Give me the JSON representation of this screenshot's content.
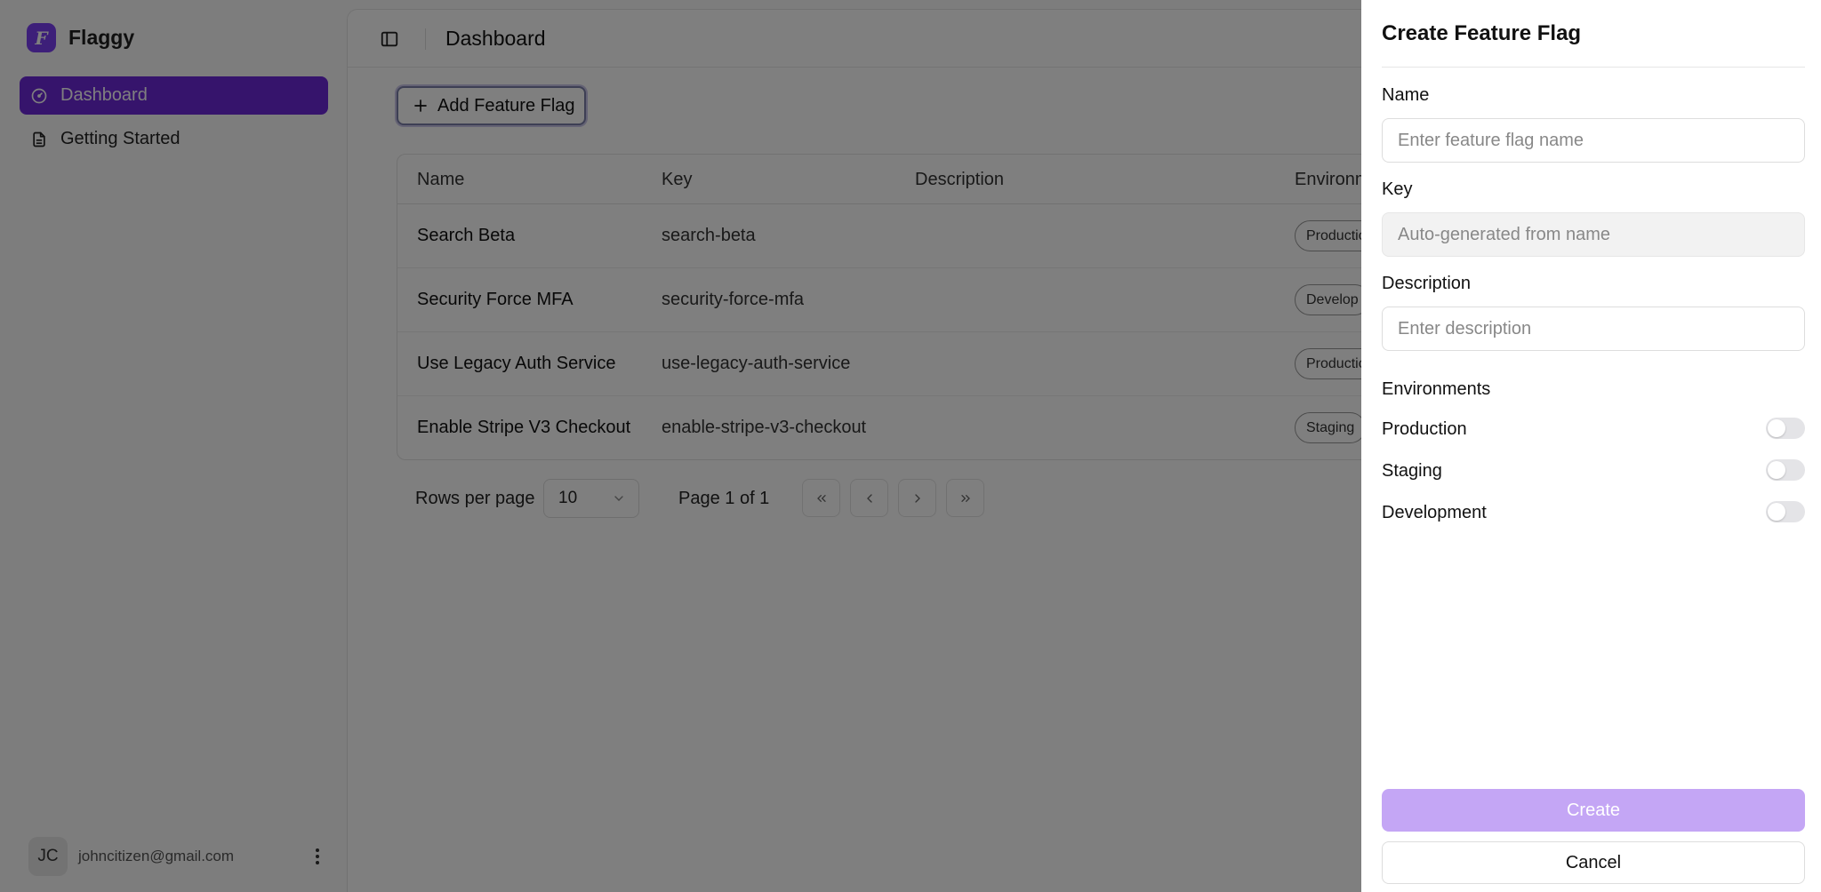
{
  "app": {
    "name": "Flaggy",
    "logo_letter": "F",
    "accent": "#6d28d9"
  },
  "sidebar": {
    "items": [
      {
        "label": "Dashboard",
        "icon": "gauge-icon",
        "active": true
      },
      {
        "label": "Getting Started",
        "icon": "file-icon",
        "active": false
      }
    ],
    "user": {
      "initials": "JC",
      "email": "johncitizen@gmail.com"
    }
  },
  "header": {
    "title": "Dashboard"
  },
  "toolbar": {
    "add_label": "Add Feature Flag"
  },
  "table": {
    "columns": [
      "Name",
      "Key",
      "Description",
      "Environm"
    ],
    "rows": [
      {
        "name": "Search Beta",
        "key": "search-beta",
        "description": "",
        "env": "Productio"
      },
      {
        "name": "Security Force MFA",
        "key": "security-force-mfa",
        "description": "",
        "env": "Develop"
      },
      {
        "name": "Use Legacy Auth Service",
        "key": "use-legacy-auth-service",
        "description": "",
        "env": "Productio"
      },
      {
        "name": "Enable Stripe V3 Checkout",
        "key": "enable-stripe-v3-checkout",
        "description": "",
        "env": "Staging"
      }
    ]
  },
  "pagination": {
    "rows_label": "Rows per page",
    "rows_value": "10",
    "page_info": "Page 1 of 1"
  },
  "drawer": {
    "title": "Create Feature Flag",
    "name_label": "Name",
    "name_placeholder": "Enter feature flag name",
    "key_label": "Key",
    "key_placeholder": "Auto-generated from name",
    "description_label": "Description",
    "description_placeholder": "Enter description",
    "environments_label": "Environments",
    "environments": [
      {
        "label": "Production",
        "enabled": false
      },
      {
        "label": "Staging",
        "enabled": false
      },
      {
        "label": "Development",
        "enabled": false
      }
    ],
    "create_label": "Create",
    "cancel_label": "Cancel"
  }
}
